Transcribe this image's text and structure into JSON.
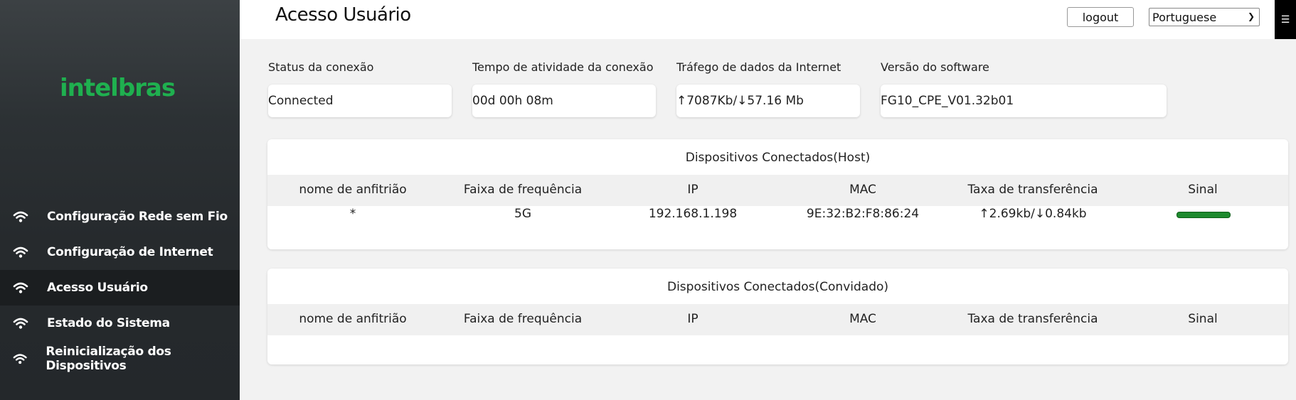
{
  "brand": {
    "logo_text": "intelbras",
    "logo_color": "#1fb04f"
  },
  "sidebar": {
    "items": [
      {
        "label": "Configuração Rede sem Fio",
        "icon": "wifi-icon",
        "active": false
      },
      {
        "label": "Configuração de Internet",
        "icon": "wifi-icon",
        "active": false
      },
      {
        "label": "Acesso Usuário",
        "icon": "wifi-icon",
        "active": true
      },
      {
        "label": "Estado do Sistema",
        "icon": "wifi-icon",
        "active": false
      },
      {
        "label": "Reinicialização dos Dispositivos",
        "icon": "wifi-icon",
        "active": false
      }
    ]
  },
  "header": {
    "title": "Acesso Usuário",
    "logout_label": "logout",
    "language_selected": "Portuguese",
    "corner_icon": "menu-icon"
  },
  "status": {
    "connection_label": "Status da conexão",
    "connection_value": "Connected",
    "uptime_label": "Tempo de atividade da conexão",
    "uptime_value": "00d 00h 08m",
    "traffic_label": "Tráfego de dados da Internet",
    "traffic_value": "↑7087Kb/↓57.16 Mb",
    "software_label": "Versão do software",
    "software_value": "FG10_CPE_V01.32b01"
  },
  "host_table": {
    "title": "Dispositivos Conectados(Host)",
    "columns": [
      "nome de anfitrião",
      "Faixa de frequência",
      "IP",
      "MAC",
      "Taxa de transferência",
      "Sinal"
    ],
    "rows": [
      {
        "hostname": "*",
        "band": "5G",
        "ip": "192.168.1.198",
        "mac": "9E:32:B2:F8:86:24",
        "rate": "↑2.69kb/↓0.84kb",
        "signal_fraction": 1.0
      }
    ]
  },
  "guest_table": {
    "title": "Dispositivos Conectados(Convidado)",
    "columns": [
      "nome de anfitrião",
      "Faixa de frequência",
      "IP",
      "MAC",
      "Taxa de transferência",
      "Sinal"
    ],
    "rows": []
  },
  "colors": {
    "signal_good": "#1e8a2e",
    "active_nav_bg": "#1b1e20"
  }
}
